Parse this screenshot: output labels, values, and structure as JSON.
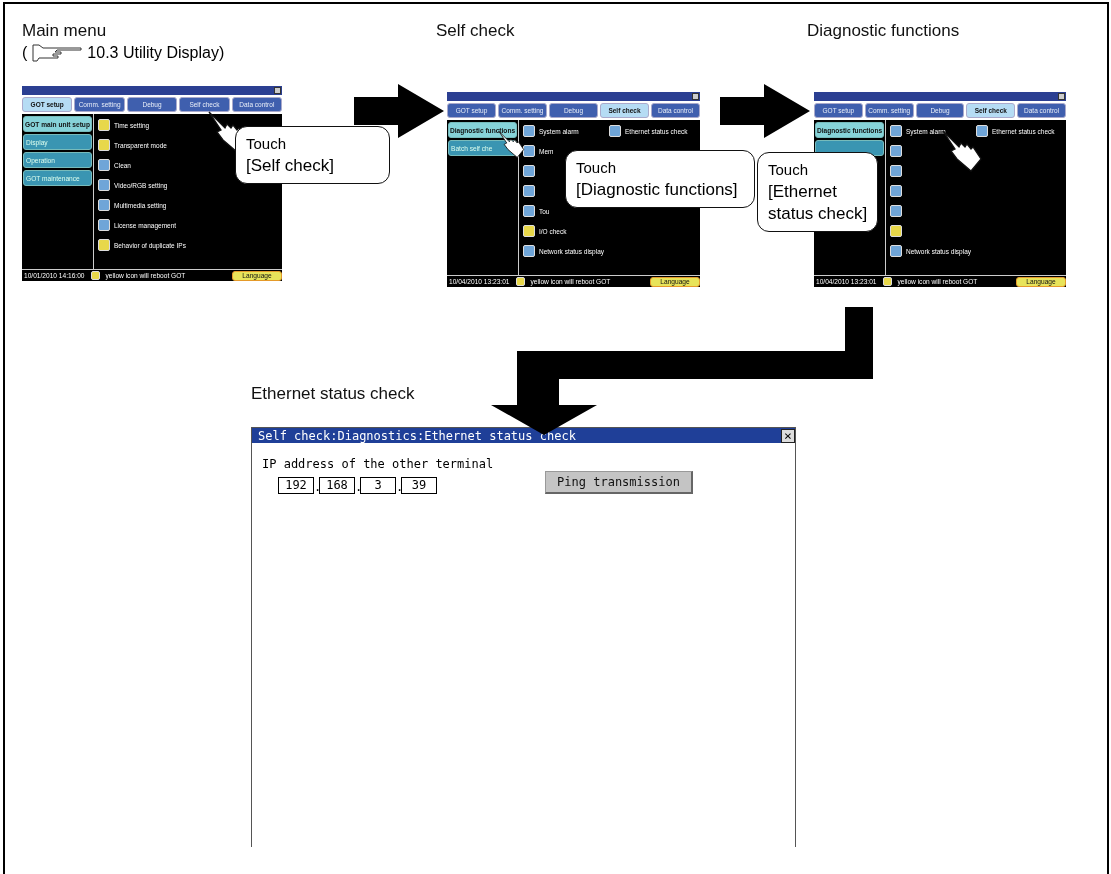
{
  "steps": [
    {
      "heading": "Main menu",
      "reference": {
        "open": "(",
        "text": "10.3 Utility Display)"
      },
      "screen": {
        "tabs": [
          {
            "label": "GOT setup",
            "selected": true
          },
          {
            "label": "Comm. setting",
            "selected": false
          },
          {
            "label": "Debug",
            "selected": false
          },
          {
            "label": "Self check",
            "selected": false
          },
          {
            "label": "Data control",
            "selected": false
          }
        ],
        "side_buttons": [
          {
            "label": "GOT main unit setup",
            "selected": true
          },
          {
            "label": "Display",
            "selected": false
          },
          {
            "label": "Operation",
            "selected": false
          },
          {
            "label": "GOT maintenance",
            "selected": false
          }
        ],
        "columns": [
          [
            {
              "label": "Time setting",
              "color": "#e8d84a"
            },
            {
              "label": "Transparent mode",
              "color": "#e8d84a"
            },
            {
              "label": "Clean",
              "color": "#6fa5d8"
            },
            {
              "label": "Video/RGB setting",
              "color": "#6fa5d8"
            },
            {
              "label": "Multimedia setting",
              "color": "#6fa5d8"
            },
            {
              "label": "License management",
              "color": "#6fa5d8"
            },
            {
              "label": "Behavior of duplicate IPs",
              "color": "#e8d84a"
            }
          ]
        ],
        "footer": {
          "date": "10/01/2010 14:16:00",
          "note": "yellow icon will reboot GOT",
          "language": "Language"
        }
      },
      "callout": {
        "lines": [
          "Touch",
          "[Self check]"
        ]
      }
    },
    {
      "heading": "Self check",
      "screen": {
        "tabs": [
          {
            "label": "GOT setup",
            "selected": false
          },
          {
            "label": "Comm. setting",
            "selected": false
          },
          {
            "label": "Debug",
            "selected": false
          },
          {
            "label": "Self check",
            "selected": true
          },
          {
            "label": "Data control",
            "selected": false
          }
        ],
        "side_buttons": [
          {
            "label": "Diagnostic functions",
            "selected": true
          },
          {
            "label": "Batch self che",
            "selected": false
          }
        ],
        "columns": [
          [
            {
              "label": "System alarm",
              "color": "#6fa5d8"
            },
            {
              "label": "Mem",
              "color": "#6fa5d8"
            },
            {
              "color": "#6fa5d8"
            },
            {
              "color": "#6fa5d8"
            },
            {
              "label": "Tou",
              "color": "#6fa5d8"
            },
            {
              "label": "I/O check",
              "color": "#e8d84a"
            },
            {
              "label": "Network status display",
              "color": "#6fa5d8"
            }
          ],
          [
            {
              "label": "Ethernet status check",
              "color": "#6fa5d8"
            }
          ]
        ],
        "footer": {
          "date": "10/04/2010 13:23:01",
          "note": "yellow icon will reboot GOT",
          "language": "Language"
        }
      },
      "callout": {
        "lines": [
          "Touch",
          "[Diagnostic functions]"
        ]
      }
    },
    {
      "heading": "Diagnostic functions",
      "screen": {
        "tabs": [
          {
            "label": "GOT setup",
            "selected": false
          },
          {
            "label": "Comm. setting",
            "selected": false
          },
          {
            "label": "Debug",
            "selected": false
          },
          {
            "label": "Self check",
            "selected": true
          },
          {
            "label": "Data control",
            "selected": false
          }
        ],
        "side_buttons": [
          {
            "label": "Diagnostic functions",
            "selected": true
          },
          {
            "selected": false
          }
        ],
        "columns": [
          [
            {
              "label": "System alarm",
              "color": "#6fa5d8"
            },
            {
              "color": "#6fa5d8"
            },
            {
              "color": "#6fa5d8"
            },
            {
              "color": "#6fa5d8"
            },
            {
              "color": "#6fa5d8"
            },
            {
              "color": "#e8d84a"
            },
            {
              "label": "Network status display",
              "color": "#6fa5d8"
            }
          ],
          [
            {
              "label": "Ethernet status check",
              "color": "#6fa5d8"
            }
          ]
        ],
        "footer": {
          "date": "10/04/2010 13:23:01",
          "note": "yellow icon will reboot GOT",
          "language": "Language"
        }
      },
      "callout": {
        "lines": [
          "Touch",
          "[Ethernet",
          "status check]"
        ]
      }
    }
  ],
  "result": {
    "heading": "Ethernet status check",
    "title": "Self check:Diagnostics:Ethernet status check",
    "close": "×",
    "label": "IP address of the other terminal",
    "octets": [
      "192",
      "168",
      "3",
      "39"
    ],
    "separators": [
      ".",
      ".",
      "."
    ],
    "button": "Ping transmission"
  }
}
